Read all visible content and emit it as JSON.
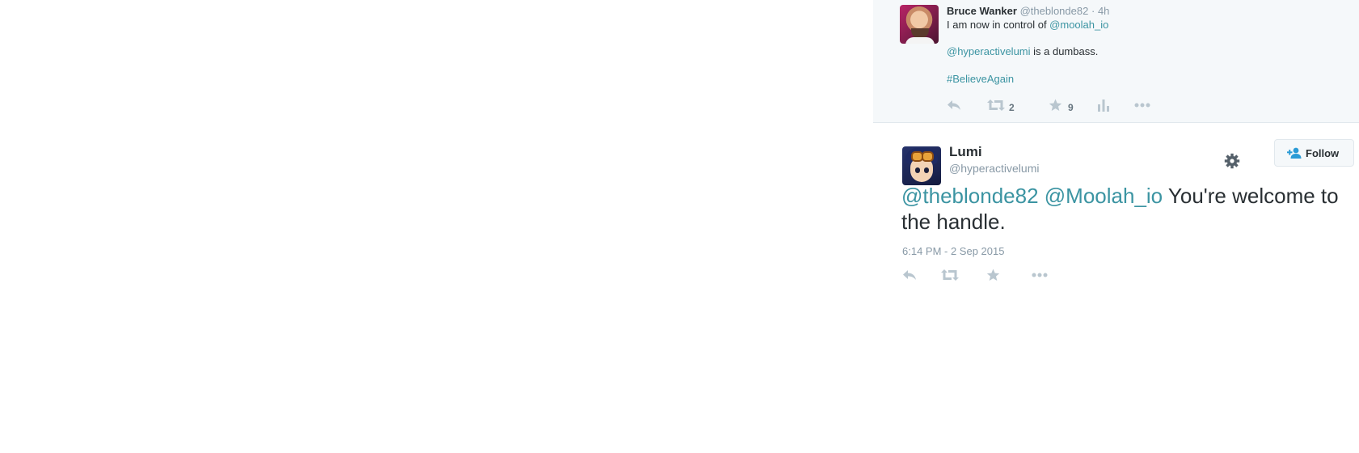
{
  "parent_tweet": {
    "display_name": "Bruce Wanker",
    "handle": "@theblonde82",
    "separator": "·",
    "age": "4h",
    "line1_prefix": "I am now in control of ",
    "line1_mention": "@moolah_io",
    "line2_mention": "@hyperactivelumi",
    "line2_suffix": " is a dumbass.",
    "line3_hashtag": "#BelieveAgain",
    "actions": {
      "reply_icon": "reply-icon",
      "retweet_icon": "retweet-icon",
      "retweet_count": "2",
      "favorite_icon": "star-icon",
      "favorite_count": "9",
      "analytics_icon": "bar-chart-icon",
      "more_icon": "ellipsis-icon"
    }
  },
  "focused_tweet": {
    "display_name": "Lumi",
    "handle": "@hyperactivelumi",
    "mention1": "@theblonde82",
    "mention2": "@Moolah_io",
    "text_rest": " You're welcome to the handle.",
    "timestamp": "6:14 PM - 2 Sep 2015",
    "follow_label": "Follow",
    "gear_icon": "gear-icon",
    "follow_icon": "add-user-icon"
  },
  "colors": {
    "link": "#3b94a2",
    "muted": "#8899a6",
    "action_icon": "#b9c6cf",
    "text": "#292f33",
    "parent_background": "#f5f8fa"
  }
}
